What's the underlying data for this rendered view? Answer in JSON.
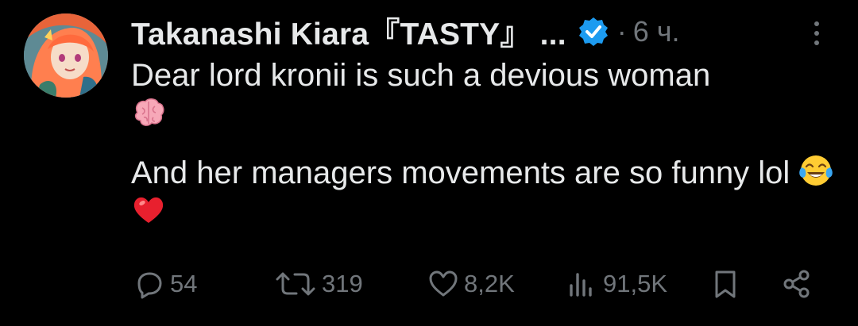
{
  "tweet": {
    "display_name": "Takanashi Kiara『TASTY』 ...",
    "separator": "·",
    "time": "6 ч.",
    "text_line_1": "Dear lord kronii is such a devious woman",
    "text_line_2": "And her managers movements are so funny lol",
    "emojis": [
      "brain",
      "face-with-tears-of-joy",
      "red-heart"
    ]
  },
  "actions": {
    "replies": "54",
    "retweets": "319",
    "likes": "8,2K",
    "views": "91,5K"
  },
  "icons": {
    "verified": "verified-badge-icon",
    "more": "more-vertical-icon",
    "reply": "reply-icon",
    "retweet": "retweet-icon",
    "like": "heart-icon",
    "views": "views-chart-icon",
    "bookmark": "bookmark-icon",
    "share": "share-icon"
  },
  "colors": {
    "background": "#000000",
    "text": "#e7e9ea",
    "secondary": "#71767b",
    "verified": "#1d9bf0"
  }
}
